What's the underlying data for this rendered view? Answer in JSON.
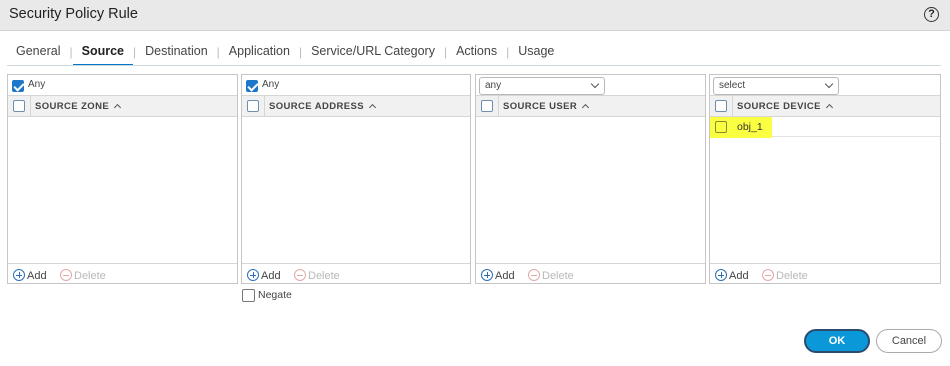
{
  "window": {
    "title": "Security Policy Rule",
    "help_icon": "?"
  },
  "tabs": [
    {
      "label": "General",
      "active": false
    },
    {
      "label": "Source",
      "active": true
    },
    {
      "label": "Destination",
      "active": false
    },
    {
      "label": "Application",
      "active": false
    },
    {
      "label": "Service/URL Category",
      "active": false
    },
    {
      "label": "Actions",
      "active": false
    },
    {
      "label": "Usage",
      "active": false
    }
  ],
  "panels": {
    "source_zone": {
      "any_label": "Any",
      "any_checked": true,
      "column": "SOURCE ZONE",
      "add": "Add",
      "delete": "Delete"
    },
    "source_address": {
      "any_label": "Any",
      "any_checked": true,
      "column": "SOURCE ADDRESS",
      "add": "Add",
      "delete": "Delete"
    },
    "source_user": {
      "select_value": "any",
      "column": "SOURCE USER",
      "add": "Add",
      "delete": "Delete"
    },
    "source_device": {
      "select_value": "select",
      "column": "SOURCE DEVICE",
      "rows": [
        "obj_1"
      ],
      "add": "Add",
      "delete": "Delete"
    }
  },
  "negate": {
    "label": "Negate",
    "checked": false
  },
  "buttons": {
    "ok": "OK",
    "cancel": "Cancel"
  },
  "colors": {
    "accent": "#0b98d8",
    "tab_underline": "#0077c8",
    "highlight": "#fbff41"
  }
}
